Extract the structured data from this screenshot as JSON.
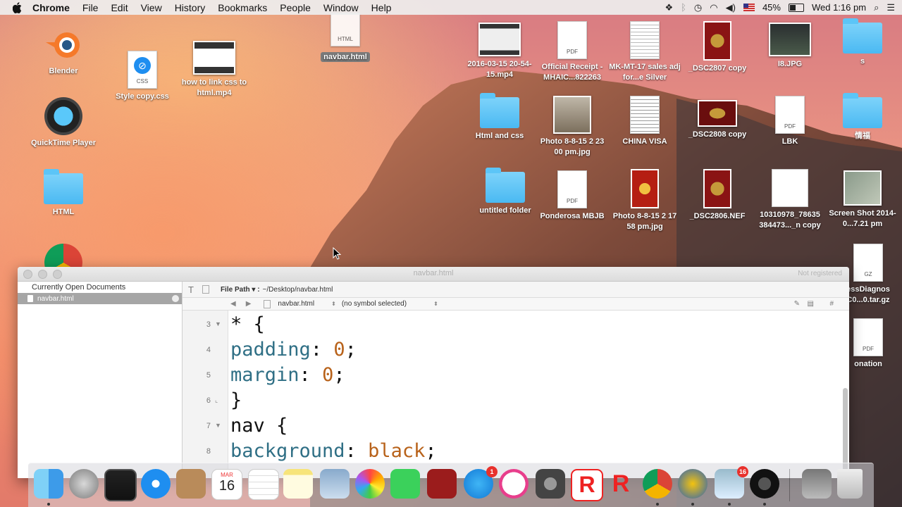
{
  "menubar": {
    "app": "Chrome",
    "items": [
      "File",
      "Edit",
      "View",
      "History",
      "Bookmarks",
      "People",
      "Window",
      "Help"
    ],
    "battery": "45%",
    "clock": "Wed 1:16 pm"
  },
  "desktop_icons": {
    "blender": "Blender",
    "style_copy": "Style copy.css",
    "how_to": "how to link css to html.mp4",
    "navbar": "navbar.html",
    "quicktime": "QuickTime Player",
    "html_folder": "HTML",
    "video_2016": "2016-03-15 20-54-15.mp4",
    "receipt": "Official Receipt - MHAIC...822263",
    "mk_mt": "MK-MT-17 sales adj for...e Silver",
    "dsc2807": "_DSC2807 copy",
    "i8": "I8.JPG",
    "s_folder": "s",
    "html_and_css": "Html and css",
    "photo_1": "Photo 8-8-15 2 23 00 pm.jpg",
    "china_visa": "CHINA VISA",
    "dsc2808": "_DSC2808 copy",
    "lbk": "LBK",
    "folder_cn": "情福",
    "untitled": "untitled folder",
    "ponderosa": "Ponderosa MBJB",
    "photo_2": "Photo 8-8-15 2 17 58 pm.jpg",
    "dsc2806": "_DSC2806.NEF",
    "img_1031": "10310978_78635 384473..._n copy",
    "screenshot": "Screen Shot 2014-0...7.21 pm",
    "diagnos": "essDiagnos C0...0.tar.gz",
    "donation": "onation",
    "file_labels": {
      "html": "HTML",
      "css": "CSS",
      "pdf": "PDF",
      "gz": "GZ"
    }
  },
  "editor": {
    "window_title": "navbar.html",
    "registration": "Not registered",
    "sidebar_header": "Currently Open Documents",
    "open_doc": "navbar.html",
    "path_label": "File Path ▾ :",
    "path_value": "~/Desktop/navbar.html",
    "nav_file": "navbar.html",
    "nav_symbol": "(no symbol selected)",
    "lines": [
      {
        "n": "3",
        "parts": [
          {
            "t": "* {",
            "c": "plain"
          }
        ]
      },
      {
        "n": "4",
        "parts": [
          {
            "t": "padding",
            "c": "kw"
          },
          {
            "t": ": ",
            "c": "plain"
          },
          {
            "t": "0",
            "c": "num"
          },
          {
            "t": ";",
            "c": "plain"
          }
        ]
      },
      {
        "n": "5",
        "parts": [
          {
            "t": "margin",
            "c": "kw"
          },
          {
            "t": ": ",
            "c": "plain"
          },
          {
            "t": "0",
            "c": "num"
          },
          {
            "t": ";",
            "c": "plain"
          }
        ]
      },
      {
        "n": "6",
        "parts": [
          {
            "t": "}",
            "c": "plain"
          }
        ]
      },
      {
        "n": "7",
        "parts": [
          {
            "t": "nav {",
            "c": "plain"
          }
        ]
      },
      {
        "n": "8",
        "parts": [
          {
            "t": "background",
            "c": "kw"
          },
          {
            "t": ": ",
            "c": "plain"
          },
          {
            "t": "black",
            "c": "val"
          },
          {
            "t": ";",
            "c": "plain"
          }
        ]
      }
    ]
  },
  "dock": {
    "calendar_month": "MAR",
    "calendar_day": "16",
    "appstore_badge": "1",
    "preview_badge": "16",
    "icons": [
      "finder-icon",
      "launchpad-icon",
      "mission-control-icon",
      "safari-icon",
      "contacts-icon",
      "calendar-icon",
      "reminders-icon",
      "notes-icon",
      "preview-icon",
      "photos-icon",
      "facetime-icon",
      "photo-booth-icon",
      "app-store-icon",
      "itunes-icon",
      "system-preferences-icon",
      "roblox-icon",
      "roblox-studio-icon",
      "chrome-icon",
      "filezilla-icon",
      "preview-alt-icon",
      "obs-icon",
      "downloads-stack-icon",
      "trash-icon"
    ]
  }
}
